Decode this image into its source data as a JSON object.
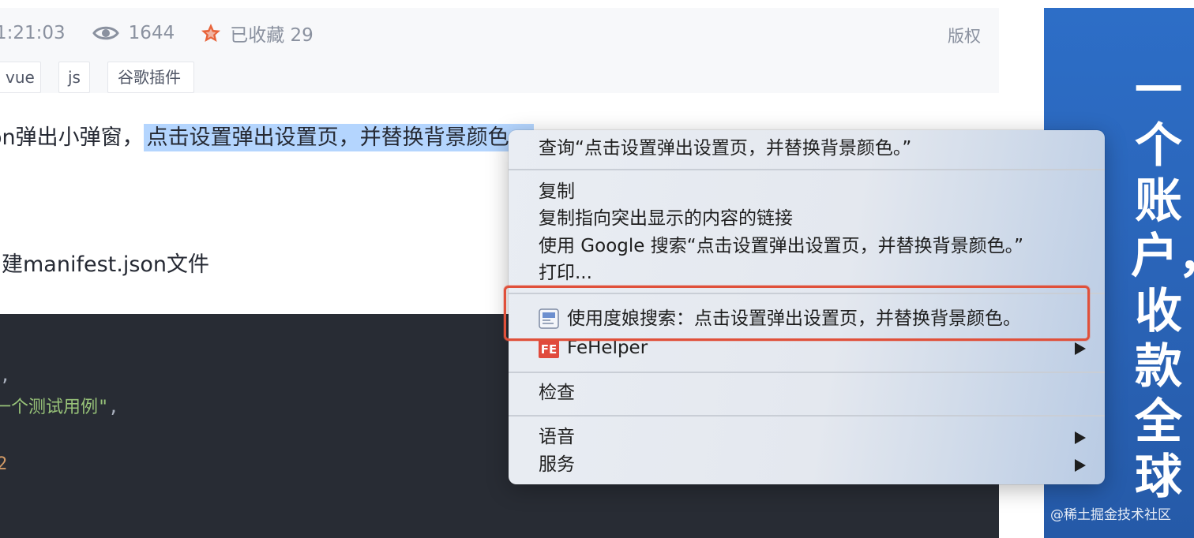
{
  "meta": {
    "time": "1:21:03",
    "views": "1644",
    "favorites": "已收藏 29",
    "copyright": "版权",
    "icons": {
      "views": "eye-icon",
      "favorites": "star-icon"
    },
    "colors": {
      "star": "#e8643a",
      "meta_text": "#8a919f"
    }
  },
  "tags": [
    "vue",
    "js",
    "谷歌插件"
  ],
  "article": {
    "para1_prefix": "on弹出小弹窗，",
    "para1_selected": "点击设置弹出设置页，并替换背景颜色。",
    "para2": "建manifest.json文件",
    "selection_color": "#b4d5fe"
  },
  "code": {
    "line_comma": ",",
    "line_string": "一个测试用例\"",
    "line_string_punct": ",",
    "line_number": "2"
  },
  "context_menu": {
    "lookup": "查询“点击设置弹出设置页，并替换背景颜色。”",
    "copy": "复制",
    "copy_link": "复制指向突出显示的内容的链接",
    "google_search": "使用 Google 搜索“点击设置弹出设置页，并替换背景颜色。”",
    "print": "打印...",
    "baidu_search": "使用度娘搜索：点击设置弹出设置页，并替换背景颜色。",
    "fehelper": "FeHelper",
    "inspect": "检查",
    "language": "语音",
    "services": "服务",
    "highlight_color": "#e0503a"
  },
  "banner": {
    "text": "一个账户，收款全球",
    "color": "#2d6ec7"
  },
  "watermark": "@稀土掘金技术社区"
}
